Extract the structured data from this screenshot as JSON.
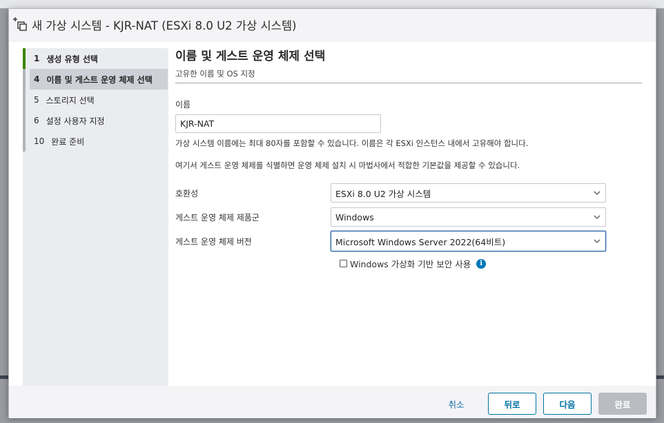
{
  "window": {
    "title": "새 가상 시스템 - KJR-NAT (ESXi 8.0 U2 가상 시스템)"
  },
  "steps": [
    {
      "number": "1",
      "label": "생성 유형 선택"
    },
    {
      "number": "4",
      "label": "이름 및 게스트 운영 체제 선택"
    },
    {
      "number": "5",
      "label": "스토리지 선택"
    },
    {
      "number": "6",
      "label": "설정 사용자 지정"
    },
    {
      "number": "10",
      "label": "완료 준비"
    }
  ],
  "page": {
    "title": "이름 및 게스트 운영 체제 선택",
    "subtitle": "고유한 이름 및 OS 지정"
  },
  "form": {
    "name_label": "이름",
    "name_value": "KJR-NAT",
    "name_help": "가상 시스템 이름에는 최대 80자를 포함할 수 있습니다. 이름은 각 ESXi 인스턴스 내에서 고유해야 합니다.",
    "os_help": "여기서 게스트 운영 체제를 식별하면 운영 체제 설치 시 마법사에서 적합한 기본값을 제공할 수 있습니다.",
    "compat_label": "호환성",
    "compat_value": "ESXi 8.0 U2 가상 시스템",
    "family_label": "게스트 운영 체제 제품군",
    "family_value": "Windows",
    "version_label": "게스트 운영 체제 버전",
    "version_value": "Microsoft Windows Server 2022(64비트)",
    "vbs_label": "Windows 가상화 기반 보안 사용",
    "info_glyph": "i"
  },
  "footer": {
    "cancel": "취소",
    "back": "뒤로",
    "next": "다음",
    "finish": "완료"
  },
  "colors": {
    "accent": "#0072a3",
    "active_step": "#3c8400",
    "focus_border": "#1d5aa0"
  }
}
